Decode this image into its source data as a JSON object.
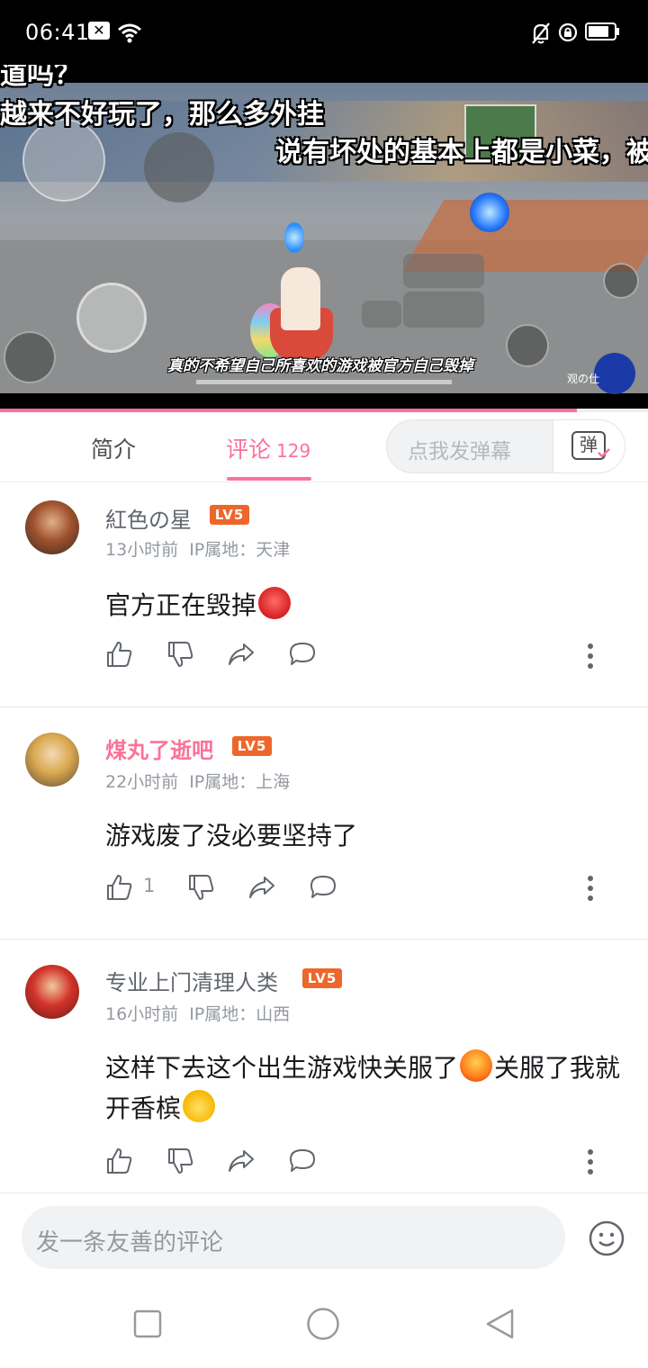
{
  "status_bar": {
    "time": "06:41",
    "icons": [
      "close-notification-icon",
      "wifi-icon",
      "bell-off-icon",
      "rotation-lock-icon",
      "battery-icon"
    ]
  },
  "video": {
    "danmaku": [
      "道吗？",
      "越来不好玩了，那么多外挂",
      "说有坏处的基本上都是小菜，被"
    ],
    "subtitle": "真的不希望自己所喜欢的游戏被官方自己毁掉",
    "watermark": "观の仕",
    "progress": 0.89
  },
  "tabs": {
    "intro_label": "简介",
    "comments_label": "评论",
    "comments_count": "129",
    "danmaku_placeholder": "点我发弹幕",
    "danmaku_button_glyph": "弹"
  },
  "comments": [
    {
      "username": "紅色の星",
      "level": "LV5",
      "time": "13小时前",
      "ip": "IP属地：天津",
      "text": "官方正在毁掉",
      "emoji": [
        "angry-emoji"
      ],
      "likes": ""
    },
    {
      "username": "煤丸了逝吧",
      "level": "LV5",
      "time": "22小时前",
      "ip": "IP属地：上海",
      "text": "游戏废了没必要坚持了",
      "likes": "1"
    },
    {
      "username": "专业上门清理人类",
      "level": "LV5",
      "time": "16小时前",
      "ip": "IP属地：山西",
      "text_part1": "这样下去这个出生游戏快关服了",
      "text_part2": "关服了我就开香槟",
      "emoji": [
        "laughing-crying-emoji",
        "celebrate-emoji"
      ],
      "likes": ""
    }
  ],
  "bottom": {
    "comment_placeholder": "发一条友善的评论"
  },
  "colors": {
    "accent": "#fb7299",
    "level_badge": "#ee672a"
  }
}
